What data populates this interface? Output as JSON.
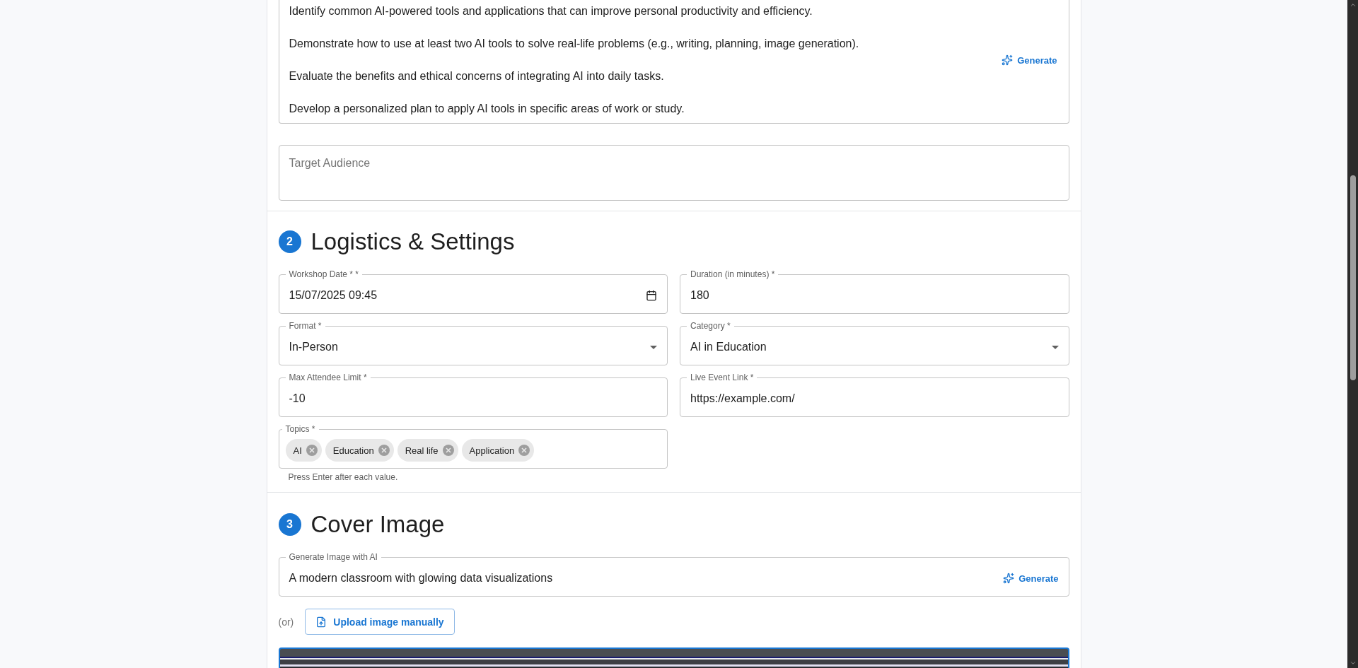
{
  "objectives": {
    "lines": [
      "Identify common AI-powered tools and applications that can improve personal productivity and efficiency.",
      "Demonstrate how to use at least two AI tools to solve real-life problems (e.g., writing, planning, image generation).",
      "Evaluate the benefits and ethical concerns of integrating AI into daily tasks.",
      "Develop a personalized plan to apply AI tools in specific areas of work or study."
    ],
    "generate_button": "Generate"
  },
  "target_audience": {
    "placeholder": "Target Audience"
  },
  "logistics": {
    "number": "2",
    "title": "Logistics & Settings",
    "fields": [
      {
        "kind": "date",
        "label": "Workshop Date * *",
        "value": "15/07/2025 09:45"
      },
      {
        "kind": "text",
        "label": "Duration (in minutes) *",
        "value": "180"
      },
      {
        "kind": "select",
        "label": "Format *",
        "value": "In-Person"
      },
      {
        "kind": "select",
        "label": "Category *",
        "value": "AI in Education"
      },
      {
        "kind": "text",
        "label": "Max Attendee Limit *",
        "value": "-10"
      },
      {
        "kind": "text",
        "label": "Live Event Link *",
        "value": "https://example.com/"
      }
    ],
    "topics": {
      "label": "Topics *",
      "chips": [
        "AI",
        "Education",
        "Real life",
        "Application"
      ],
      "helper": "Press Enter after each value."
    }
  },
  "cover_image": {
    "number": "3",
    "title": "Cover Image",
    "prompt_field": {
      "label": "Generate Image with AI",
      "value": "A modern classroom with glowing data visualizations",
      "generate_button": "Generate"
    },
    "or_text": "(or)",
    "upload_button": "Upload image manually"
  }
}
